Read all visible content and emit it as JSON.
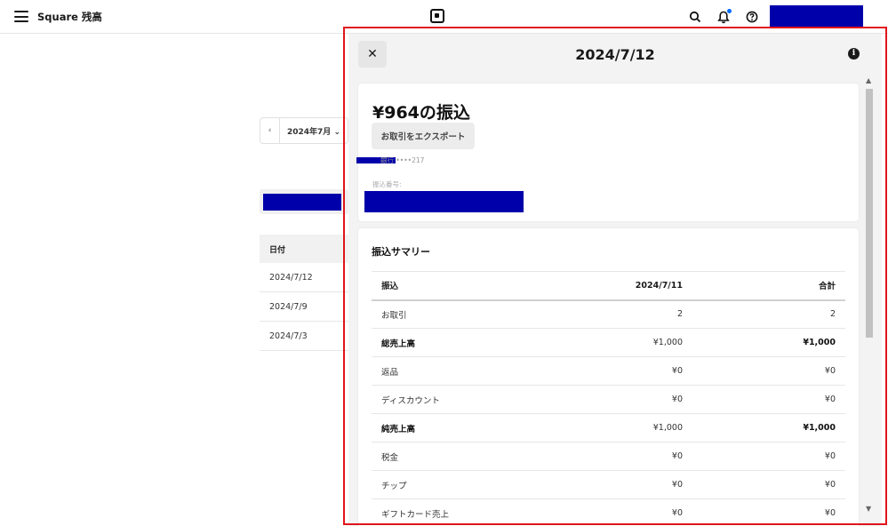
{
  "topbar": {
    "app_title": "Square 残高",
    "icons": [
      "menu-icon",
      "square-logo-icon",
      "search-icon",
      "bell-icon",
      "help-icon"
    ],
    "notification_dot_color": "#006aff",
    "redaction_color": "#0000aa"
  },
  "background_page": {
    "month_picker": {
      "prev": "‹",
      "label": "2024年7月 ⌄"
    },
    "table_header": "日付",
    "rows": [
      "2024/7/12",
      "2024/7/9",
      "2024/7/3"
    ]
  },
  "panel": {
    "close": "✕",
    "title": "2024/7/12",
    "info": "i",
    "amount_title": "¥964の振込",
    "export_button": "お取引をエクスポート",
    "bank_line": "銀行 ••••217",
    "transfer_label": "振込番号:",
    "summary": {
      "title": "振込サマリー",
      "headers": [
        "振込",
        "2024/7/11",
        "合計"
      ],
      "rows": [
        {
          "label": "お取引",
          "a": "2",
          "b": "2"
        },
        {
          "label": "総売上高",
          "a": "¥1,000",
          "b": "¥1,000"
        },
        {
          "label": "返品",
          "a": "¥0",
          "b": "¥0"
        },
        {
          "label": "ディスカウント",
          "a": "¥0",
          "b": "¥0"
        },
        {
          "label": "純売上高",
          "a": "¥1,000",
          "b": "¥1,000"
        },
        {
          "label": "税金",
          "a": "¥0",
          "b": "¥0"
        },
        {
          "label": "チップ",
          "a": "¥0",
          "b": "¥0"
        },
        {
          "label": "ギフトカード売上",
          "a": "¥0",
          "b": "¥0"
        }
      ]
    },
    "scroll_up": "▲",
    "scroll_down": "▼"
  },
  "highlight_color": "#e0151b"
}
